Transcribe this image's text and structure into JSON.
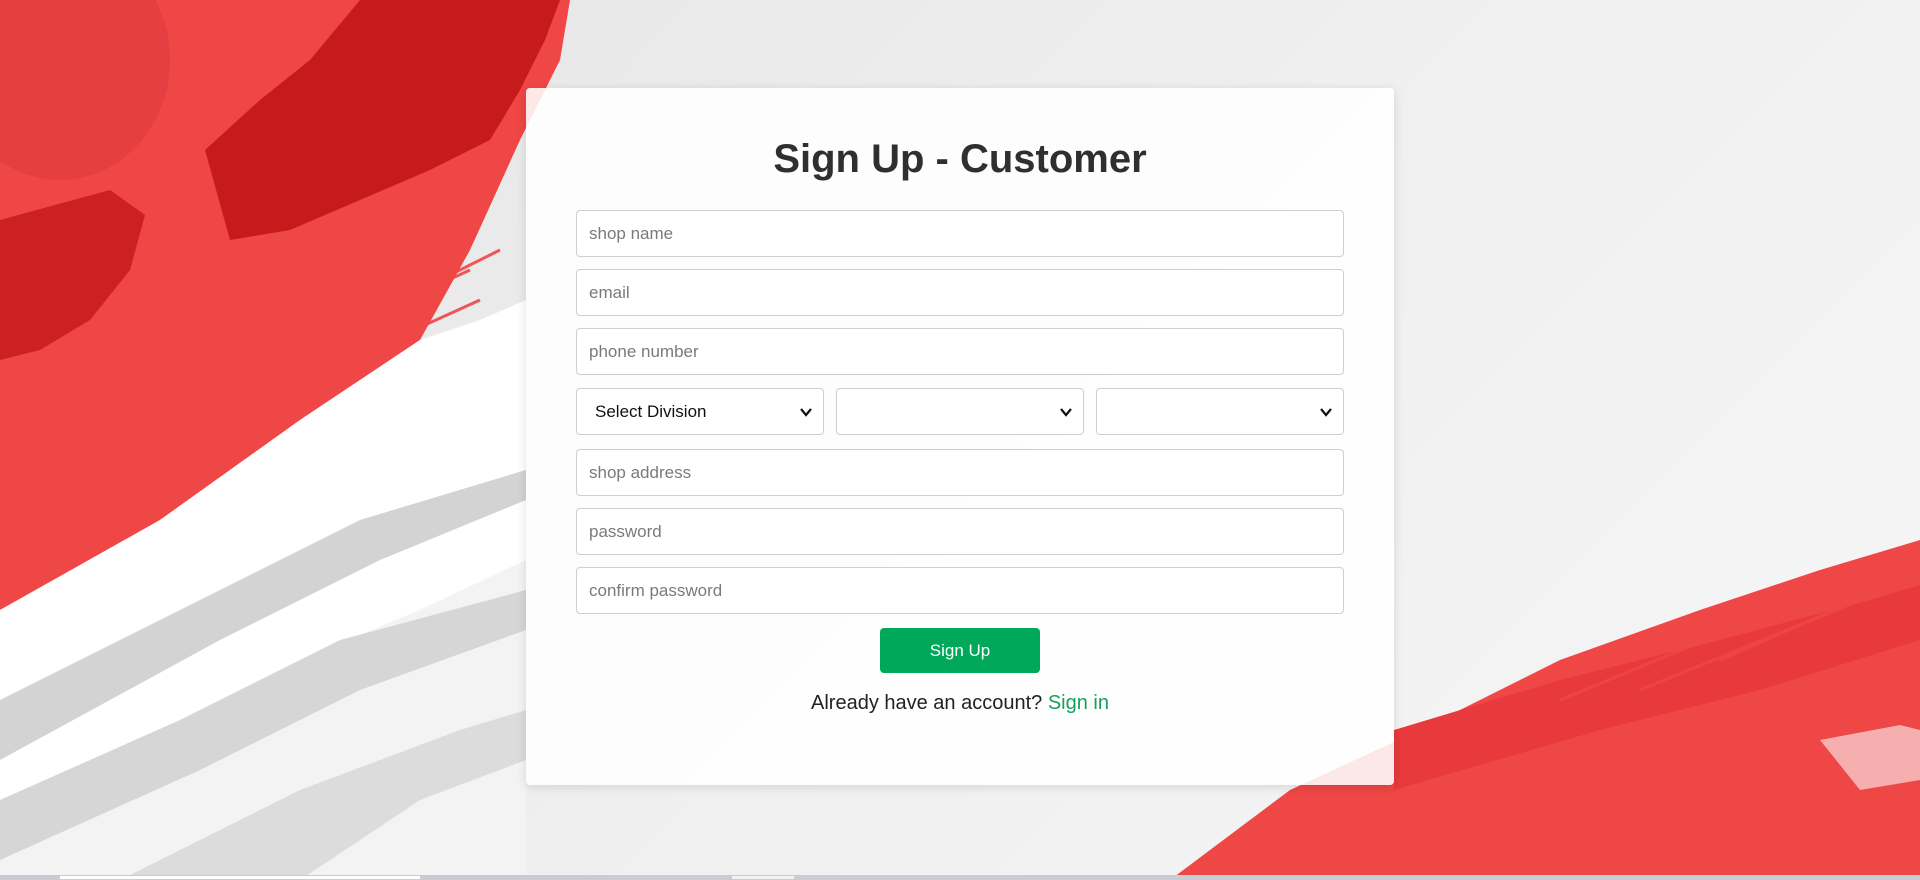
{
  "page": {
    "title": "Sign Up - Customer"
  },
  "form": {
    "shop_name_placeholder": "shop name",
    "email_placeholder": "email",
    "phone_placeholder": "phone number",
    "division_select": {
      "selected": "Select Division"
    },
    "district_select": {
      "selected": ""
    },
    "upazila_select": {
      "selected": ""
    },
    "shop_address_placeholder": "shop address",
    "password_placeholder": "password",
    "confirm_password_placeholder": "confirm password",
    "submit_label": "Sign Up"
  },
  "footer": {
    "prompt": "Already have an account?",
    "signin_label": "Sign in"
  },
  "colors": {
    "accent_button": "#00a85a",
    "link": "#17a05a",
    "brush_red": "#ef4646",
    "brush_dark_red": "#c71a1d"
  }
}
